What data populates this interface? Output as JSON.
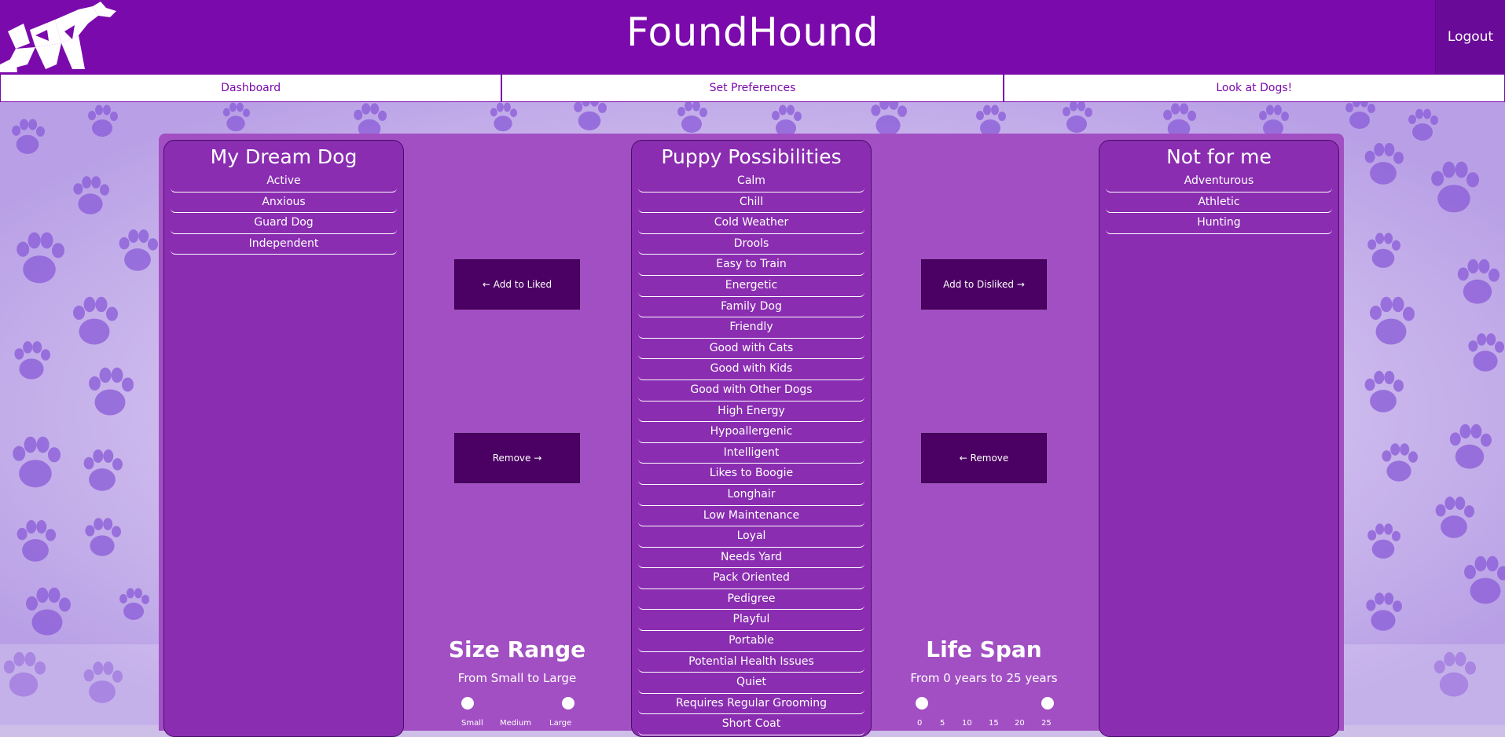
{
  "header": {
    "brand": "FoundHound",
    "logout": "Logout",
    "colors": {
      "header": "#7a0aab",
      "panel": "#8a2db1",
      "button": "#4b0063"
    }
  },
  "nav": {
    "dashboard": "Dashboard",
    "preferences": "Set Preferences",
    "look": "Look at Dogs!"
  },
  "liked": {
    "title": "My Dream Dog",
    "items": [
      "Active",
      "Anxious",
      "Guard Dog",
      "Independent"
    ]
  },
  "possibilities": {
    "title": "Puppy Possibilities",
    "items": [
      "Calm",
      "Chill",
      "Cold Weather",
      "Drools",
      "Easy to Train",
      "Energetic",
      "Family Dog",
      "Friendly",
      "Good with Cats",
      "Good with Kids",
      "Good with Other Dogs",
      "High Energy",
      "Hypoallergenic",
      "Intelligent",
      "Likes to Boogie",
      "Longhair",
      "Low Maintenance",
      "Loyal",
      "Needs Yard",
      "Pack Oriented",
      "Pedigree",
      "Playful",
      "Portable",
      "Potential Health Issues",
      "Quiet",
      "Requires Regular Grooming",
      "Short Coat"
    ]
  },
  "disliked": {
    "title": "Not for me",
    "items": [
      "Adventurous",
      "Athletic",
      "Hunting"
    ]
  },
  "buttons": {
    "add_liked": "← Add to Liked",
    "remove_liked": "Remove →",
    "add_disliked": "Add to Disliked →",
    "remove_disliked": "← Remove"
  },
  "size_range": {
    "title": "Size Range",
    "subtitle": "From Small to Large",
    "labels": [
      "Small",
      "Medium",
      "Large"
    ]
  },
  "life_span": {
    "title": "Life Span",
    "subtitle": "From 0 years to 25 years",
    "ticks": [
      "0",
      "5",
      "10",
      "15",
      "20",
      "25"
    ]
  }
}
